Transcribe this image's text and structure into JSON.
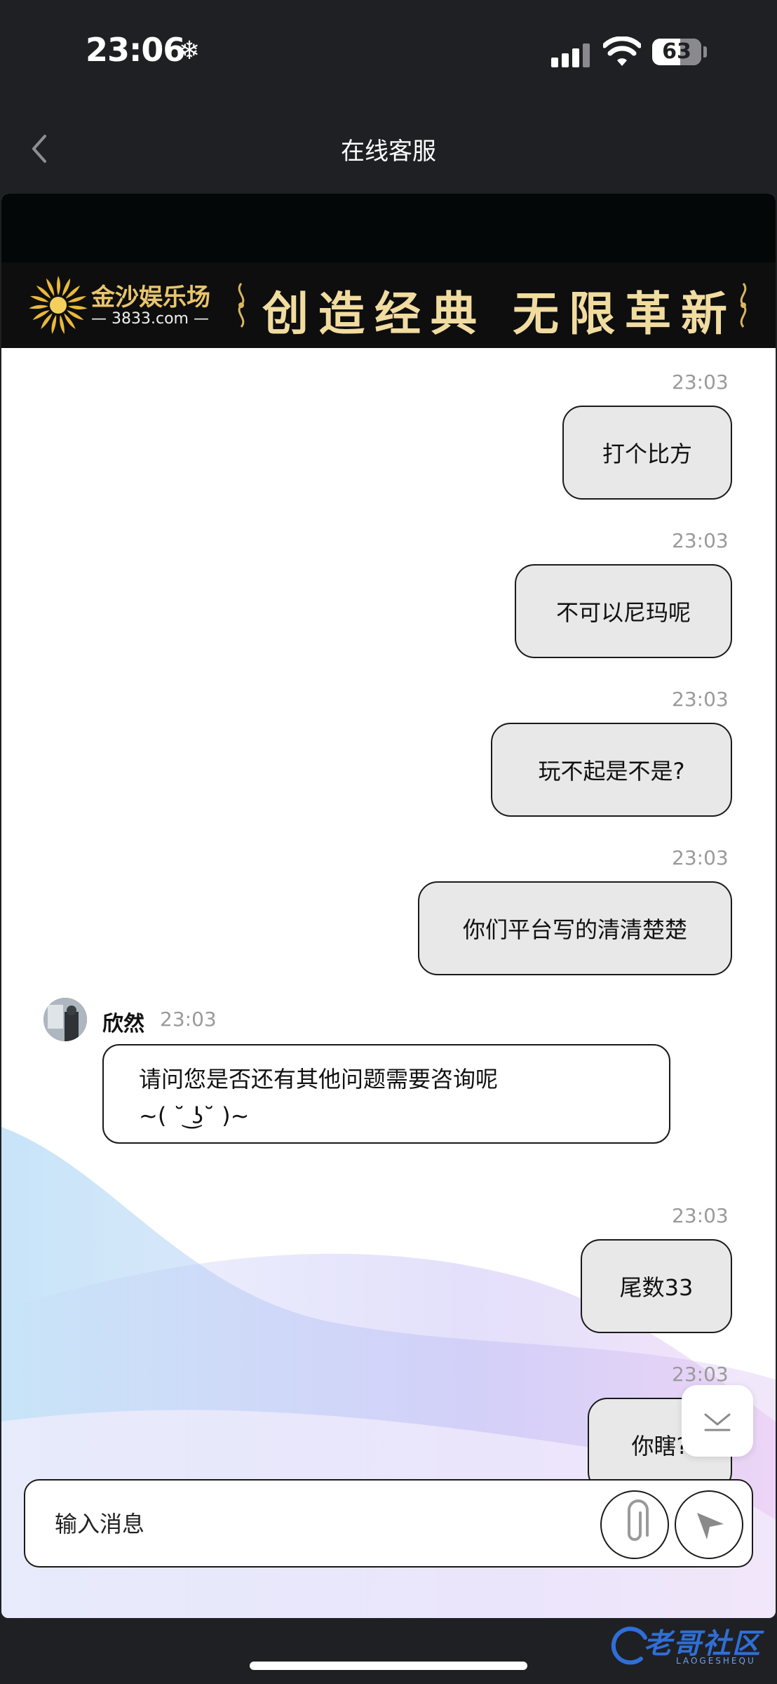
{
  "status_bar": {
    "time": "23:06",
    "snow_glyph": "❄",
    "battery": "63"
  },
  "nav": {
    "title": "在线客服"
  },
  "banner": {
    "logo_name": "金沙娱乐场",
    "logo_url": "— 3833.com —",
    "slogan": "创造经典 无限革新",
    "colors": {
      "gold": "#e9c46a",
      "banner_bg": "#0e0e0e"
    }
  },
  "messages": [
    {
      "side": "out",
      "time": "23:03",
      "text": "打个比方"
    },
    {
      "side": "out",
      "time": "23:03",
      "text": "不可以尼玛呢"
    },
    {
      "side": "out",
      "time": "23:03",
      "text": "玩不起是不是?"
    },
    {
      "side": "out",
      "time": "23:03",
      "text": "你们平台写的清清楚楚"
    },
    {
      "side": "in",
      "sender": "欣然",
      "time": "23:03",
      "line1": "请问您是否还有其他问题需要咨询呢",
      "line2": "~( ˘ ͜ʖ˘ )~"
    },
    {
      "side": "out",
      "time": "23:03",
      "text": "尾数33"
    },
    {
      "side": "out",
      "time": "23:03",
      "text": "你瞎?"
    }
  ],
  "composer": {
    "placeholder": "输入消息",
    "attach_icon": "paperclip-icon",
    "send_icon": "send-icon"
  },
  "watermark": {
    "title": "老哥社区",
    "subtitle": "LAOGESHEQU"
  }
}
